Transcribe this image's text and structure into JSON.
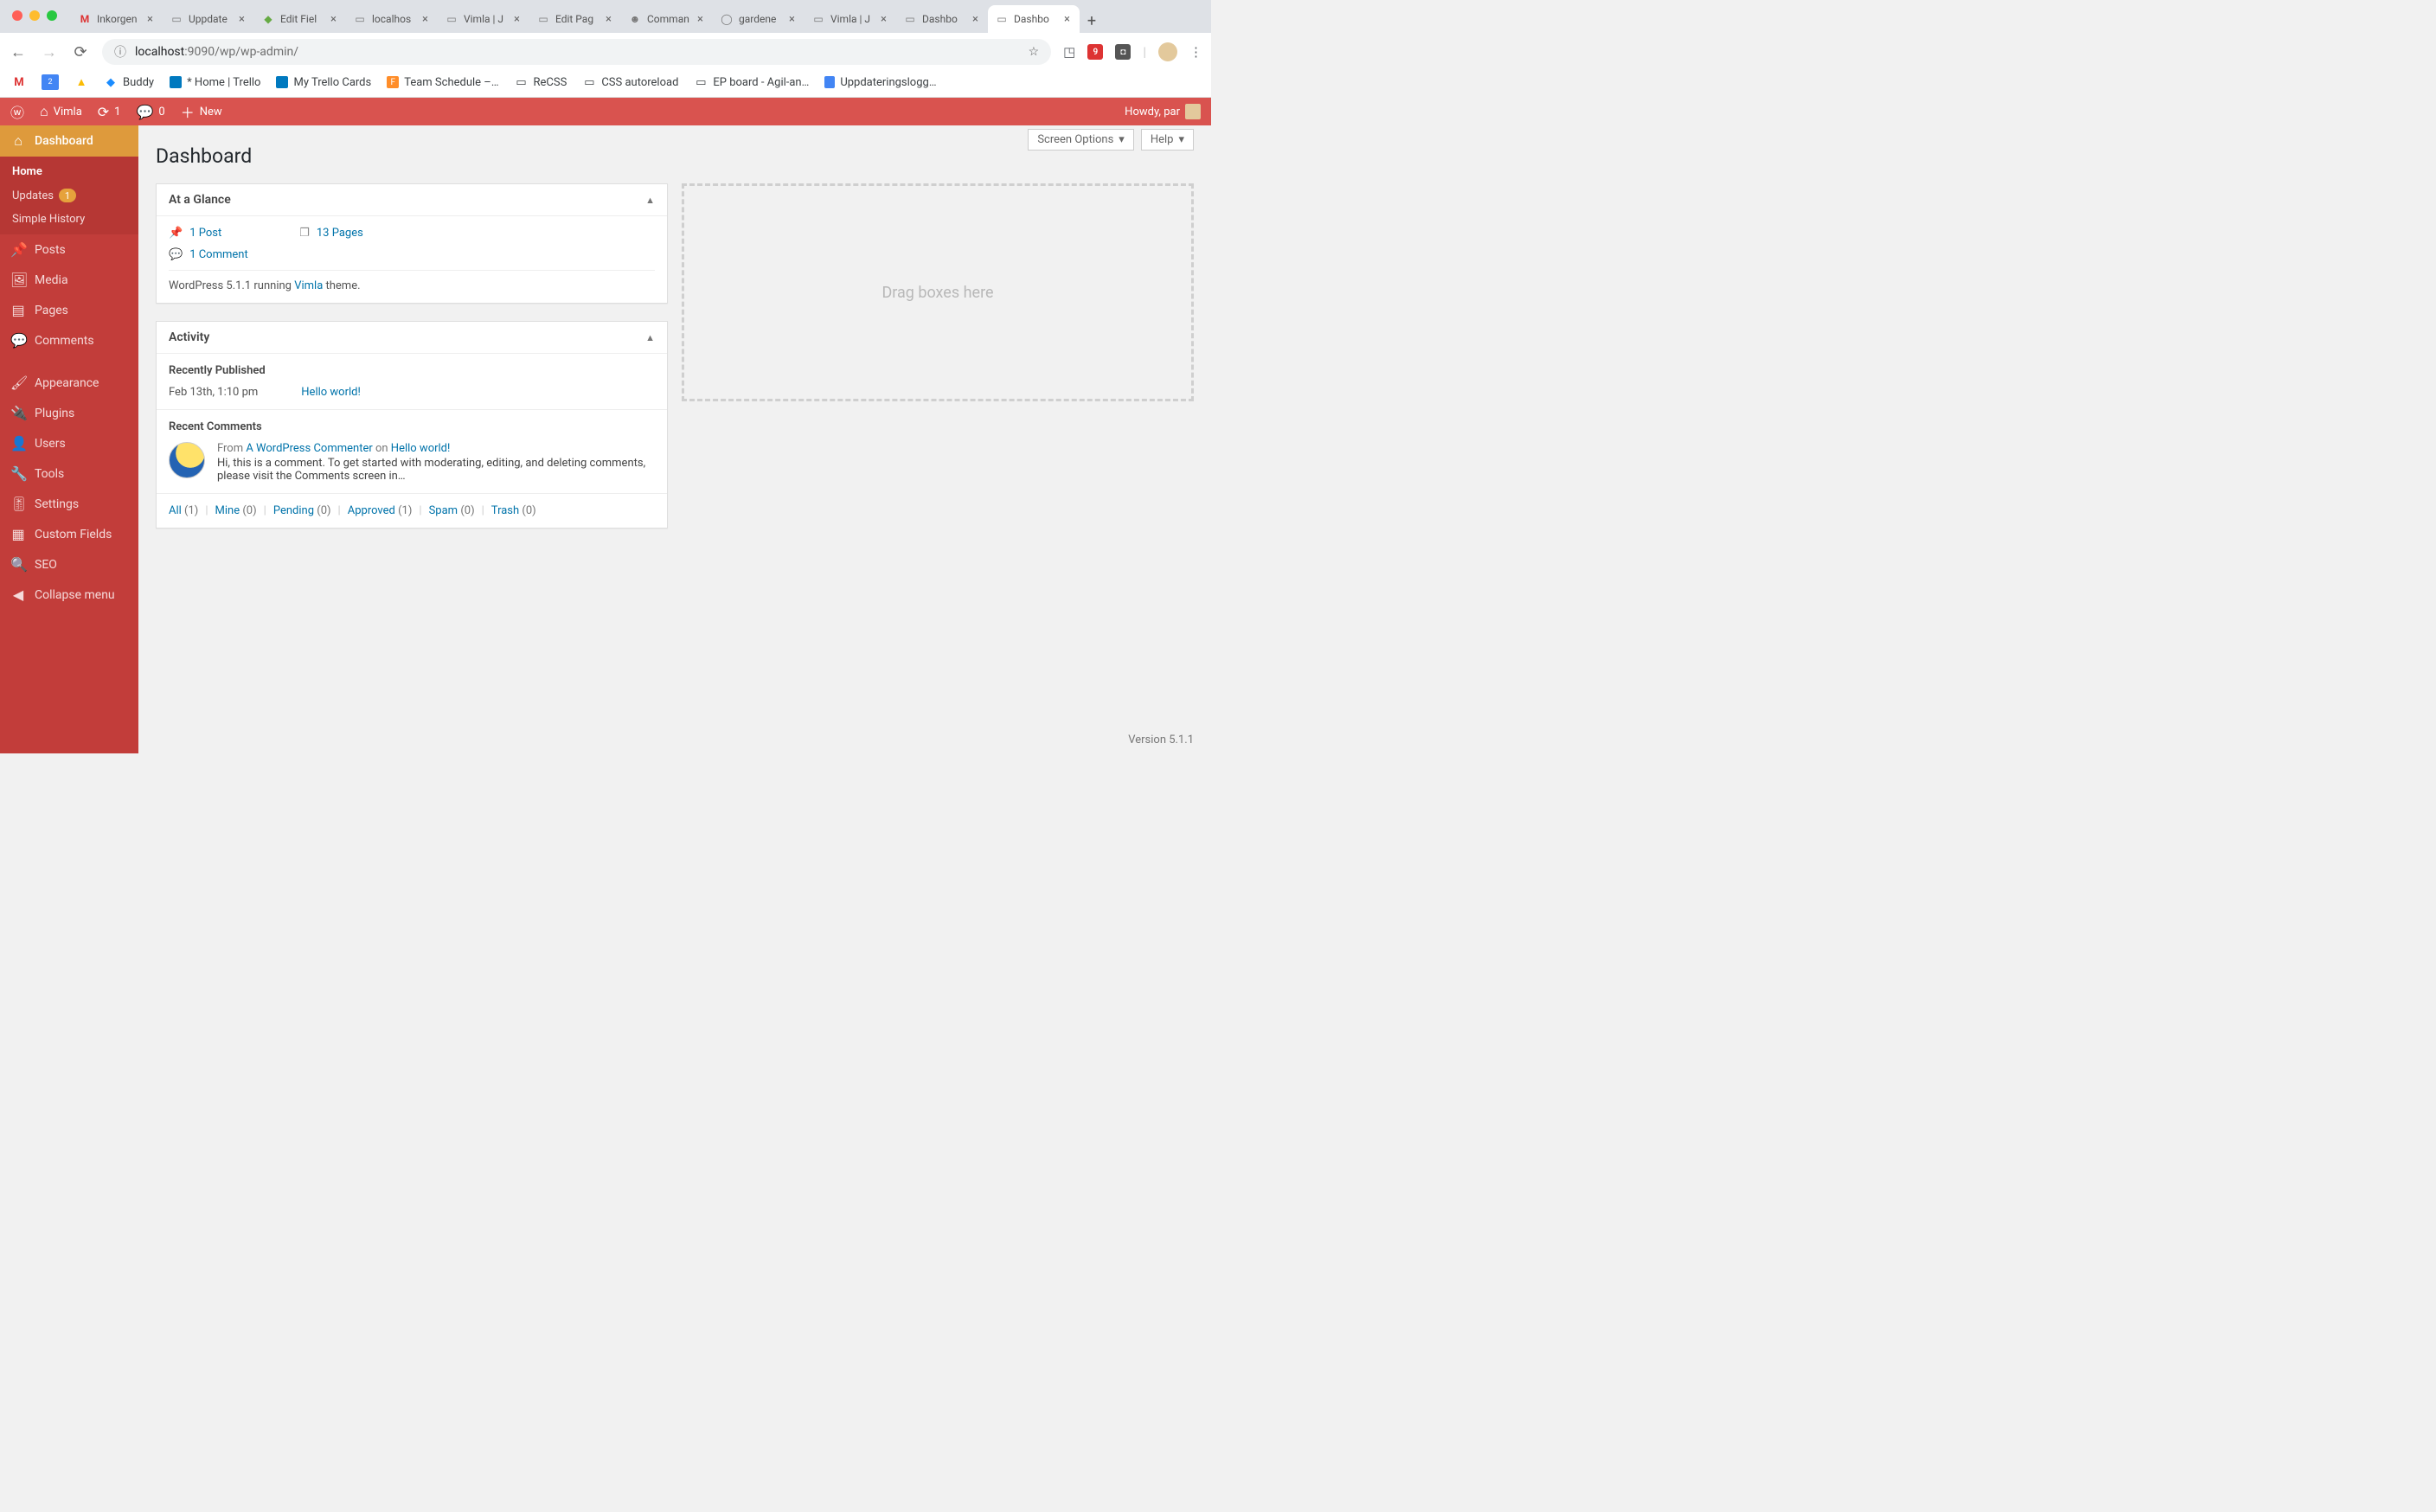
{
  "browser": {
    "tabs": [
      {
        "title": "Inkorgen",
        "fav": "M"
      },
      {
        "title": "Uppdate",
        "fav": "□"
      },
      {
        "title": "Edit Fiel",
        "fav": "◆"
      },
      {
        "title": "localhos",
        "fav": "▭"
      },
      {
        "title": "Vimla | J",
        "fav": "▭"
      },
      {
        "title": "Edit Pag",
        "fav": "▭"
      },
      {
        "title": "Comman",
        "fav": "☻"
      },
      {
        "title": "gardene",
        "fav": "○"
      },
      {
        "title": "Vimla | J",
        "fav": "▭"
      },
      {
        "title": "Dashbo",
        "fav": "▭"
      },
      {
        "title": "Dashbo",
        "fav": "▭",
        "active": true
      }
    ],
    "url_host": "localhost",
    "url_port": ":9090",
    "url_path": "/wp/wp-admin/",
    "bookmarks": [
      {
        "label": ""
      },
      {
        "label": ""
      },
      {
        "label": ""
      },
      {
        "label": ""
      },
      {
        "label": "Buddy"
      },
      {
        "label": "* Home | Trello"
      },
      {
        "label": "My Trello Cards"
      },
      {
        "label": "Team Schedule –…"
      },
      {
        "label": "ReCSS"
      },
      {
        "label": "CSS autoreload"
      },
      {
        "label": "EP board - Agil-an…"
      },
      {
        "label": "Uppdateringslogg…"
      }
    ]
  },
  "adminbar": {
    "site_name": "Vimla",
    "update_count": "1",
    "comment_count": "0",
    "new_label": "New",
    "howdy": "Howdy, par"
  },
  "sidebar": {
    "dashboard": "Dashboard",
    "submenu": {
      "home": "Home",
      "updates": "Updates",
      "updates_badge": "1",
      "simple_history": "Simple History"
    },
    "posts": "Posts",
    "media": "Media",
    "pages": "Pages",
    "comments": "Comments",
    "appearance": "Appearance",
    "plugins": "Plugins",
    "users": "Users",
    "tools": "Tools",
    "settings": "Settings",
    "custom_fields": "Custom Fields",
    "seo": "SEO",
    "collapse": "Collapse menu"
  },
  "screen_meta": {
    "screen_options": "Screen Options",
    "help": "Help"
  },
  "page_title": "Dashboard",
  "glance": {
    "heading": "At a Glance",
    "posts": "1 Post",
    "pages": "13 Pages",
    "comments": "1 Comment",
    "version_pre": "WordPress 5.1.1 running ",
    "theme_link": "Vimla",
    "version_post": " theme."
  },
  "activity": {
    "heading": "Activity",
    "recently_published": "Recently Published",
    "pub_date": "Feb 13th, 1:10 pm",
    "pub_title": "Hello world!",
    "recent_comments": "Recent Comments",
    "comment_from": "From ",
    "comment_author": "A WordPress Commenter",
    "comment_on": " on ",
    "comment_post": "Hello world!",
    "comment_excerpt": "Hi, this is a comment. To get started with moderating, editing, and deleting comments, please visit the Comments screen in…",
    "filters": {
      "all": "All",
      "all_n": "(1)",
      "mine": "Mine",
      "mine_n": "(0)",
      "pending": "Pending",
      "pending_n": "(0)",
      "approved": "Approved",
      "approved_n": "(1)",
      "spam": "Spam",
      "spam_n": "(0)",
      "trash": "Trash",
      "trash_n": "(0)"
    }
  },
  "dropzone_text": "Drag boxes here",
  "footer_version": "Version 5.1.1"
}
